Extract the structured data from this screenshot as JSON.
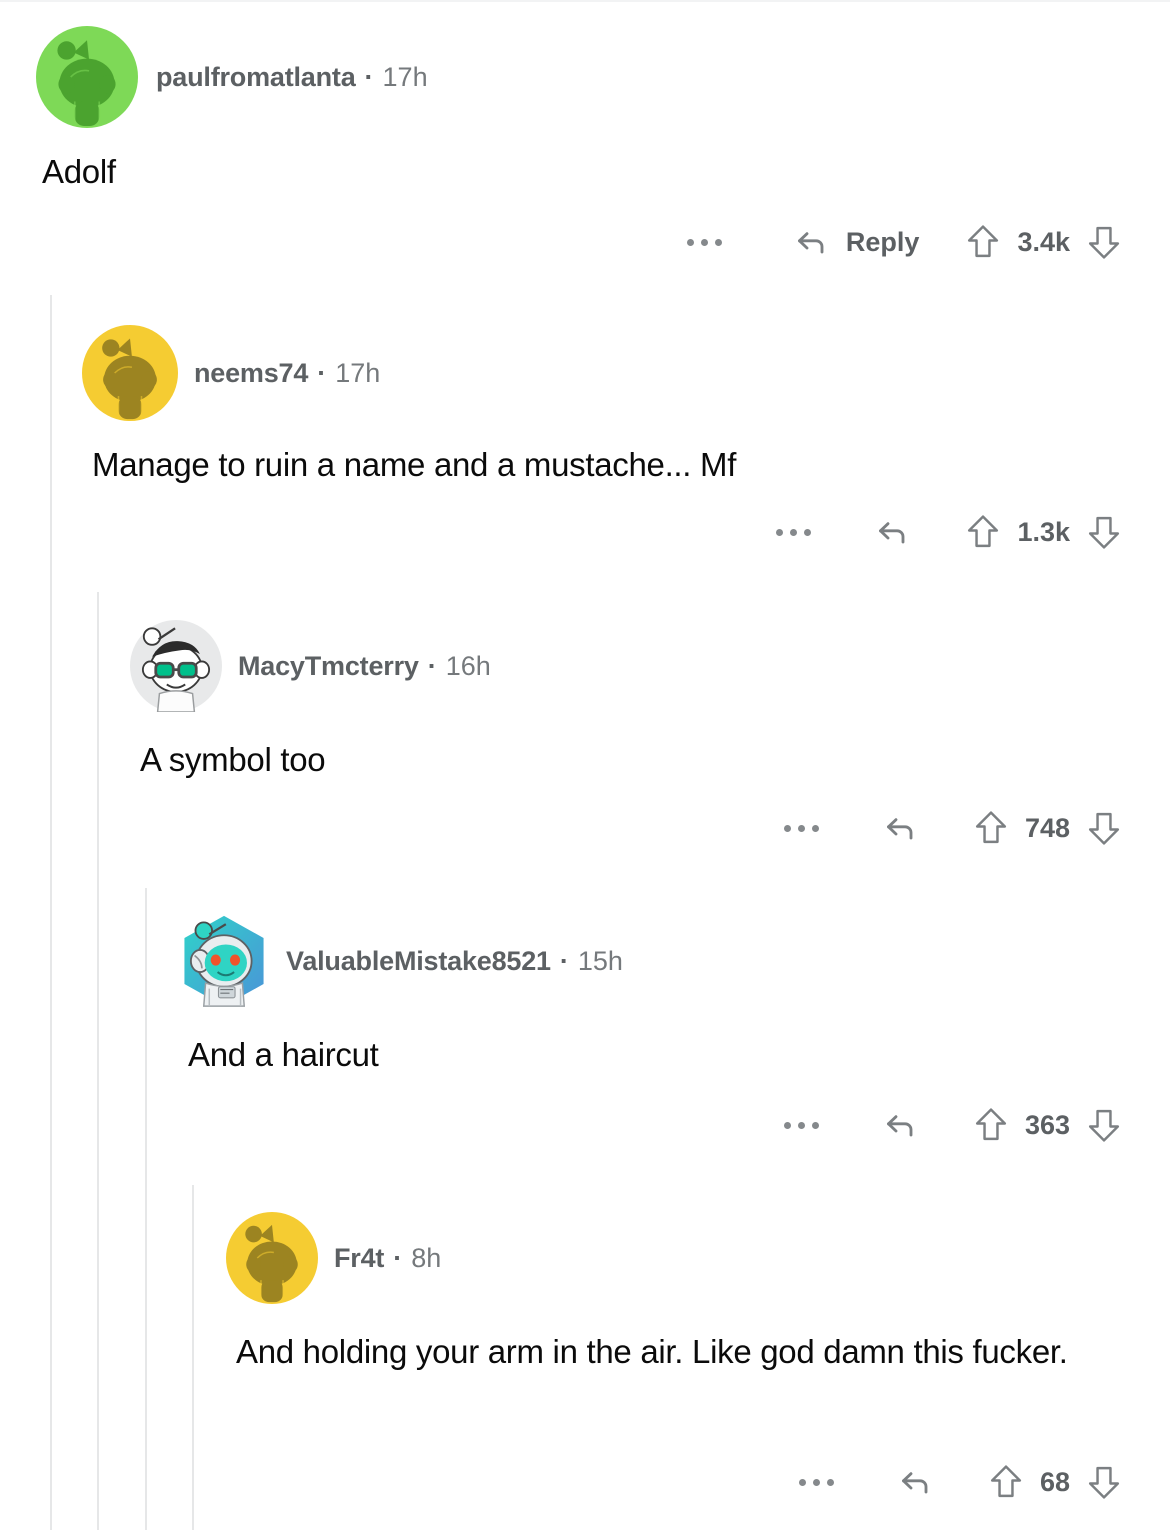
{
  "app": {
    "platform": "reddit",
    "view": "comment-thread",
    "background_color": "#ffffff",
    "rail_color": "#e6e7e8",
    "username_color": "#5c6063",
    "body_text_color": "#0b0b0b"
  },
  "icons": {
    "overflow": "ellipsis-icon",
    "reply": "reply-arrow-icon",
    "upvote": "upvote-arrow-icon",
    "downvote": "downvote-arrow-icon"
  },
  "separator": "·",
  "comments": [
    {
      "id": "c1",
      "depth": 0,
      "username": "paulfromatlanta",
      "age": "17h",
      "body": "Adolf",
      "score": "3.4k",
      "reply_label": "Reply",
      "show_reply_label": true,
      "avatar": {
        "name": "snoo-avatar-green",
        "style": "snoo",
        "background": "#7ed957",
        "figure": "#4ba32f",
        "shape": "circle"
      }
    },
    {
      "id": "c2",
      "depth": 1,
      "username": "neems74",
      "age": "17h",
      "body": "Manage to ruin a name and a mustache... Mf",
      "score": "1.3k",
      "reply_label": "Reply",
      "show_reply_label": false,
      "avatar": {
        "name": "snoo-avatar-yellow",
        "style": "snoo",
        "background": "#f5cc32",
        "figure": "#9c8421",
        "shape": "circle"
      }
    },
    {
      "id": "c3",
      "depth": 2,
      "username": "MacyTmcterry",
      "age": "16h",
      "body": "A symbol too",
      "score": "748",
      "reply_label": "Reply",
      "show_reply_label": false,
      "avatar": {
        "name": "snoo-avatar-glasses",
        "style": "snoo-glasses",
        "background": "#e8e9ea",
        "figure": "#ffffff",
        "hair": "#2b2b2b",
        "lens": "#00c08b",
        "shape": "circle"
      }
    },
    {
      "id": "c4",
      "depth": 3,
      "username": "ValuableMistake8521",
      "age": "15h",
      "body": "And a haircut",
      "score": "363",
      "reply_label": "Reply",
      "show_reply_label": false,
      "avatar": {
        "name": "snoo-avatar-astronaut",
        "style": "snoo-astronaut",
        "background": "#34c3c9",
        "figure": "#2fd4c4",
        "helmet": "#e9edef",
        "eyes": "#f0532c",
        "shape": "hexagon"
      }
    },
    {
      "id": "c5",
      "depth": 4,
      "username": "Fr4t",
      "age": "8h",
      "body": "And holding your arm in the air. Like god damn this fucker.",
      "score": "68",
      "reply_label": "Reply",
      "show_reply_label": false,
      "avatar": {
        "name": "snoo-avatar-yellow",
        "style": "snoo",
        "background": "#f5cc32",
        "figure": "#9c8421",
        "shape": "circle"
      }
    }
  ]
}
